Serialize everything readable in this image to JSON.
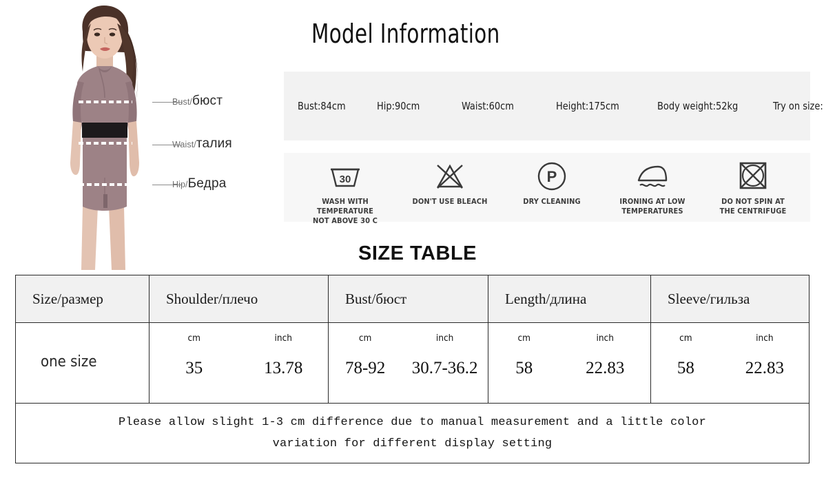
{
  "headings": {
    "model_information": "Model Information",
    "size_table": "SIZE TABLE"
  },
  "model_photo": {
    "alt": "female-model-in-mauve-bodycon-dress",
    "measure_labels": [
      {
        "en": "Bust/",
        "ru": "бюст"
      },
      {
        "en": "Waist/",
        "ru": "талия"
      },
      {
        "en": "Hip/",
        "ru": "Бедра"
      }
    ]
  },
  "model_info": {
    "items": [
      "Bust:84cm",
      "Hip:90cm",
      "Waist:60cm",
      "Height:175cm",
      "Body weight:52kg",
      "Try on size:"
    ]
  },
  "care_instructions": [
    {
      "icon": "wash-tub-30-icon",
      "label": "WASH WITH TEMPERATURE\nNOT ABOVE 30 C",
      "temp": "30"
    },
    {
      "icon": "no-bleach-triangle-icon",
      "label": "DON'T USE BLEACH"
    },
    {
      "icon": "dry-clean-p-circle-icon",
      "label": "DRY CLEANING",
      "letter": "P"
    },
    {
      "icon": "iron-low-temperature-icon",
      "label": "IRONING AT LOW\nTEMPERATURES"
    },
    {
      "icon": "no-spin-centrifuge-icon",
      "label": "DO NOT SPIN AT\nTHE CENTRIFUGE"
    }
  ],
  "size_table": {
    "headers": [
      "Size/размер",
      "Shoulder/плечо",
      "Bust/бюст",
      "Length/длина",
      "Sleeve/гильза"
    ],
    "units": [
      "cm",
      "inch"
    ],
    "row": {
      "size": "one size",
      "shoulder_cm": "35",
      "shoulder_inch": "13.78",
      "bust_cm": "78-92",
      "bust_inch": "30.7-36.2",
      "length_cm": "58",
      "length_inch": "22.83",
      "sleeve_cm": "58",
      "sleeve_inch": "22.83"
    },
    "note_line1": "Please allow slight 1-3 cm difference due to manual measurement and a little color",
    "note_line2": "variation for different display setting"
  },
  "colors": {
    "panel_bg": "#f2f2f2",
    "care_bg": "#f7f7f7",
    "table_header_bg": "#f1f1f1",
    "border": "#2a2a2a",
    "dress": "#9d8286",
    "belt": "#1d1a1c"
  }
}
